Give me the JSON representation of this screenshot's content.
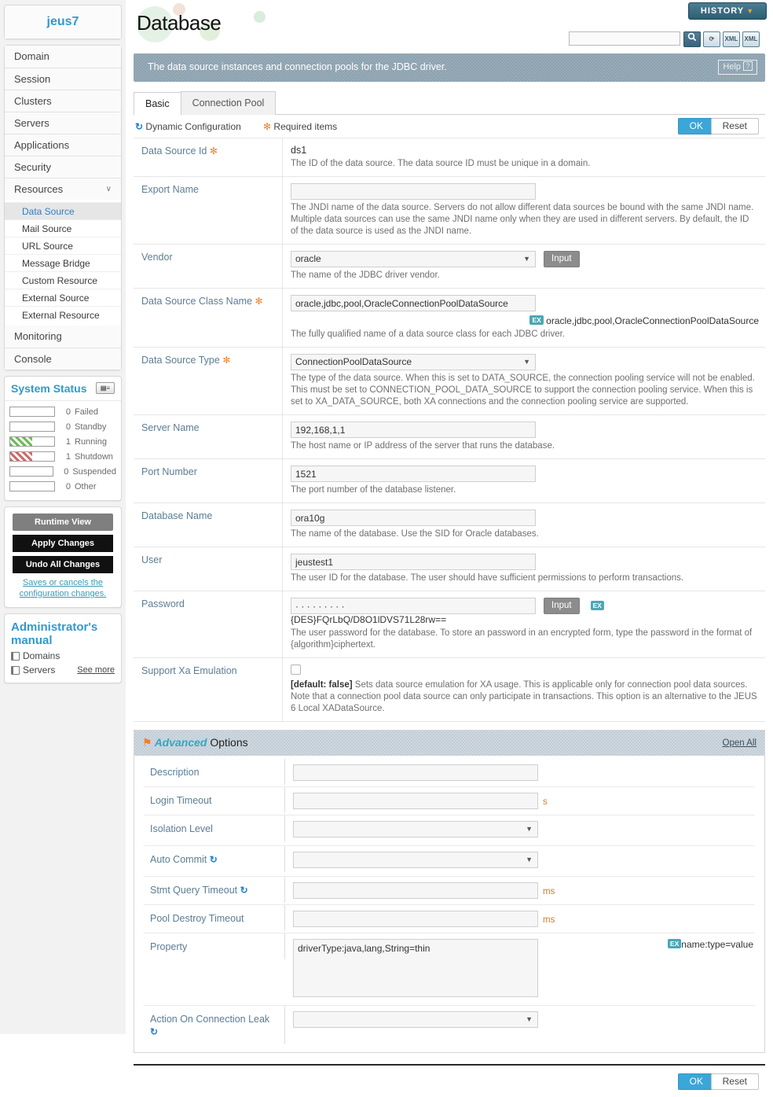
{
  "sidebar": {
    "brand": "jeus7",
    "nav": [
      {
        "label": "Domain",
        "expandable": false
      },
      {
        "label": "Session",
        "expandable": false
      },
      {
        "label": "Clusters",
        "expandable": false
      },
      {
        "label": "Servers",
        "expandable": false
      },
      {
        "label": "Applications",
        "expandable": false
      },
      {
        "label": "Security",
        "expandable": false
      },
      {
        "label": "Resources",
        "expandable": true,
        "chevron": "∨"
      }
    ],
    "resources_children": [
      {
        "label": "Data Source",
        "active": true
      },
      {
        "label": "Mail Source",
        "active": false
      },
      {
        "label": "URL Source",
        "active": false
      },
      {
        "label": "Message Bridge",
        "active": false
      },
      {
        "label": "Custom Resource",
        "active": false
      },
      {
        "label": "External Source",
        "active": false
      },
      {
        "label": "External Resource",
        "active": false
      }
    ],
    "nav_tail": [
      {
        "label": "Monitoring"
      },
      {
        "label": "Console"
      }
    ],
    "status": {
      "title": "System Status",
      "screen_icon": "monitor-icon",
      "rows": [
        {
          "count": "0",
          "label": "Failed",
          "fill": 0,
          "color": "#9e9e9e"
        },
        {
          "count": "0",
          "label": "Standby",
          "fill": 0,
          "color": "#9e9e9e"
        },
        {
          "count": "1",
          "label": "Running",
          "fill": 50,
          "color": "#6cba5a"
        },
        {
          "count": "1",
          "label": "Shutdown",
          "fill": 50,
          "color": "#d06a6a"
        },
        {
          "count": "0",
          "label": "Suspended",
          "fill": 0,
          "color": "#9e9e9e"
        },
        {
          "count": "0",
          "label": "Other",
          "fill": 0,
          "color": "#9e9e9e"
        }
      ]
    },
    "actions": {
      "runtime_view": "Runtime View",
      "apply_changes": "Apply Changes",
      "undo_all": "Undo All Changes",
      "note": "Saves or cancels the configuration changes."
    },
    "manual": {
      "title": "Administrator's manual",
      "items": [
        "Domains",
        "Servers"
      ],
      "see_more": "See more"
    }
  },
  "header": {
    "title": "Database",
    "history_label": "HISTORY",
    "history_caret": "▼",
    "search_value": "",
    "icons": [
      {
        "name": "search-icon",
        "glyph": "⚲"
      },
      {
        "name": "refresh-icon",
        "glyph": "⟳"
      },
      {
        "name": "xml-import-icon",
        "glyph": "XML"
      },
      {
        "name": "xml-export-icon",
        "glyph": "XML"
      }
    ],
    "description": "The data source instances and connection pools for the JDBC driver.",
    "help_label": "Help",
    "help_mark": "?"
  },
  "tabs": [
    {
      "label": "Basic",
      "active": true
    },
    {
      "label": "Connection Pool",
      "active": false
    }
  ],
  "legend": {
    "dynamic_config": "Dynamic Configuration",
    "required_items": "Required items",
    "dynamic_icon": "↻",
    "required_icon": "✻",
    "ok": "OK",
    "reset": "Reset"
  },
  "basic_form": [
    {
      "label": "Data Source Id",
      "required": true,
      "control": "text-static",
      "value": "ds1",
      "help": "The ID of the data source. The data source ID must be unique in a domain."
    },
    {
      "label": "Export Name",
      "required": false,
      "control": "input",
      "value": "",
      "help": "The JNDI name of the data source. Servers do not allow different data sources be bound with the same JNDI name. Multiple data sources can use the same JNDI name only when they are used in different servers. By default, the ID of the data source is used as the JNDI name."
    },
    {
      "label": "Vendor",
      "required": false,
      "control": "select-input",
      "value": "oracle",
      "button": "Input",
      "help": "The name of the JDBC driver vendor."
    },
    {
      "label": "Data Source Class Name",
      "required": true,
      "control": "input-example",
      "value": "oracle,jdbc,pool,OracleConnectionPoolDataSource",
      "example_badge": "EX",
      "example": "oracle,jdbc,pool,OracleConnectionPoolDataSource",
      "help": "The fully qualified name of a data source class for each JDBC driver."
    },
    {
      "label": "Data Source Type",
      "required": true,
      "control": "select",
      "value": "ConnectionPoolDataSource",
      "help": "The type of the data source. When this is set to DATA_SOURCE, the connection pooling service will not be enabled. This must be set to CONNECTION_POOL_DATA_SOURCE to support the connection pooling service. When this is set to XA_DATA_SOURCE, both XA connections and the connection pooling service are supported."
    },
    {
      "label": "Server Name",
      "required": false,
      "control": "input",
      "value": "192,168,1,1",
      "help": "The host name or IP address of the server that runs the database."
    },
    {
      "label": "Port Number",
      "required": false,
      "control": "input",
      "value": "1521",
      "help": "The port number of the database listener."
    },
    {
      "label": "Database Name",
      "required": false,
      "control": "input",
      "value": "ora10g",
      "help": "The name of the database. Use the SID for Oracle databases."
    },
    {
      "label": "User",
      "required": false,
      "control": "input",
      "value": "jeustest1",
      "help": "The user ID for the database. The user should have sufficient permissions to perform transactions."
    },
    {
      "label": "Password",
      "required": false,
      "control": "password",
      "value": "· · · · · · · · ·",
      "button": "Input",
      "example_badge": "EX",
      "example": "{DES}FQrLbQ/D8O1lDVS71L28rw==",
      "help": "The user password for the database. To store an password in an encrypted form, type the password in the format of {algorithm}ciphertext."
    },
    {
      "label": "Support Xa Emulation",
      "required": false,
      "control": "checkbox",
      "checked": false,
      "help_bold": "[default: false]",
      "help": "Sets data source emulation for XA usage. This is applicable only for connection pool data sources. Note that a connection pool data source can only participate in transactions. This option is an alternative to the JEUS 6 Local XADataSource."
    }
  ],
  "advanced": {
    "pin_icon": "⚑",
    "title_em": "Advanced",
    "title_rest": " Options",
    "open_all": "Open All",
    "rows": [
      {
        "label": "Description",
        "control": "input",
        "value": "",
        "unit": "",
        "dynamic": false
      },
      {
        "label": "Login Timeout",
        "control": "input",
        "value": "",
        "unit": "s",
        "dynamic": false
      },
      {
        "label": "Isolation Level",
        "control": "select",
        "value": "",
        "unit": "",
        "dynamic": false
      },
      {
        "label": "Auto Commit",
        "control": "select",
        "value": "",
        "unit": "",
        "dynamic": true
      },
      {
        "label": "Stmt Query Timeout",
        "control": "input",
        "value": "",
        "unit": "ms",
        "dynamic": true
      },
      {
        "label": "Pool Destroy Timeout",
        "control": "input",
        "value": "",
        "unit": "ms",
        "dynamic": false
      },
      {
        "label": "Property",
        "control": "textarea",
        "value": "driverType:java,lang,String=thin",
        "unit": "",
        "dynamic": false,
        "example_badge": "EX",
        "example": "name:type=value"
      },
      {
        "label": "Action On Connection Leak",
        "control": "select",
        "value": "",
        "unit": "",
        "dynamic": true
      }
    ]
  },
  "footer": {
    "ok": "OK",
    "reset": "Reset"
  }
}
